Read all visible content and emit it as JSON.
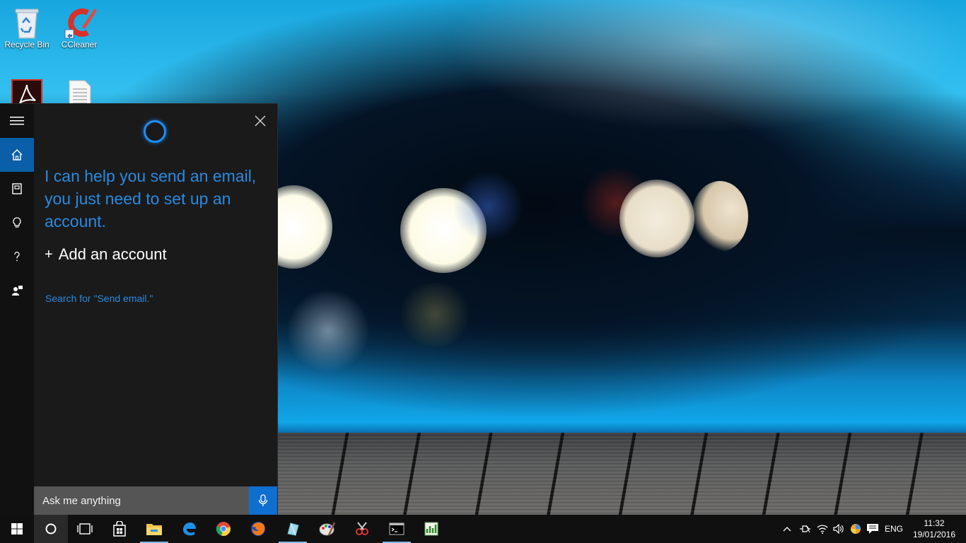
{
  "desktop": {
    "icons": [
      {
        "label": "Recycle Bin",
        "icon": "recycle-bin-icon"
      },
      {
        "label": "CCleaner",
        "icon": "ccleaner-icon"
      },
      {
        "label": "",
        "icon": "adobe-reader-icon"
      },
      {
        "label": "",
        "icon": "text-document-icon"
      }
    ]
  },
  "cortana": {
    "message": "I can help you send an email, you just need to set up an account.",
    "add_account_label": "Add an account",
    "add_account_plus": "+",
    "search_link": "Search for \"Send email.\"",
    "ask_placeholder": "Ask me anything",
    "rail_items": [
      {
        "name": "menu",
        "icon": "hamburger-icon",
        "glyph": "☰"
      },
      {
        "name": "home",
        "icon": "home-icon",
        "glyph": "⌂"
      },
      {
        "name": "notebook",
        "icon": "notebook-icon",
        "glyph": "▣"
      },
      {
        "name": "reminders",
        "icon": "lightbulb-icon",
        "glyph": "💡"
      },
      {
        "name": "help",
        "icon": "question-icon",
        "glyph": "?"
      },
      {
        "name": "feedback",
        "icon": "feedback-icon",
        "glyph": "☗"
      }
    ],
    "accent_color": "#2a8ae0"
  },
  "taskbar": {
    "tray": {
      "language": "ENG",
      "time": "11:32",
      "date": "19/01/2016"
    }
  }
}
